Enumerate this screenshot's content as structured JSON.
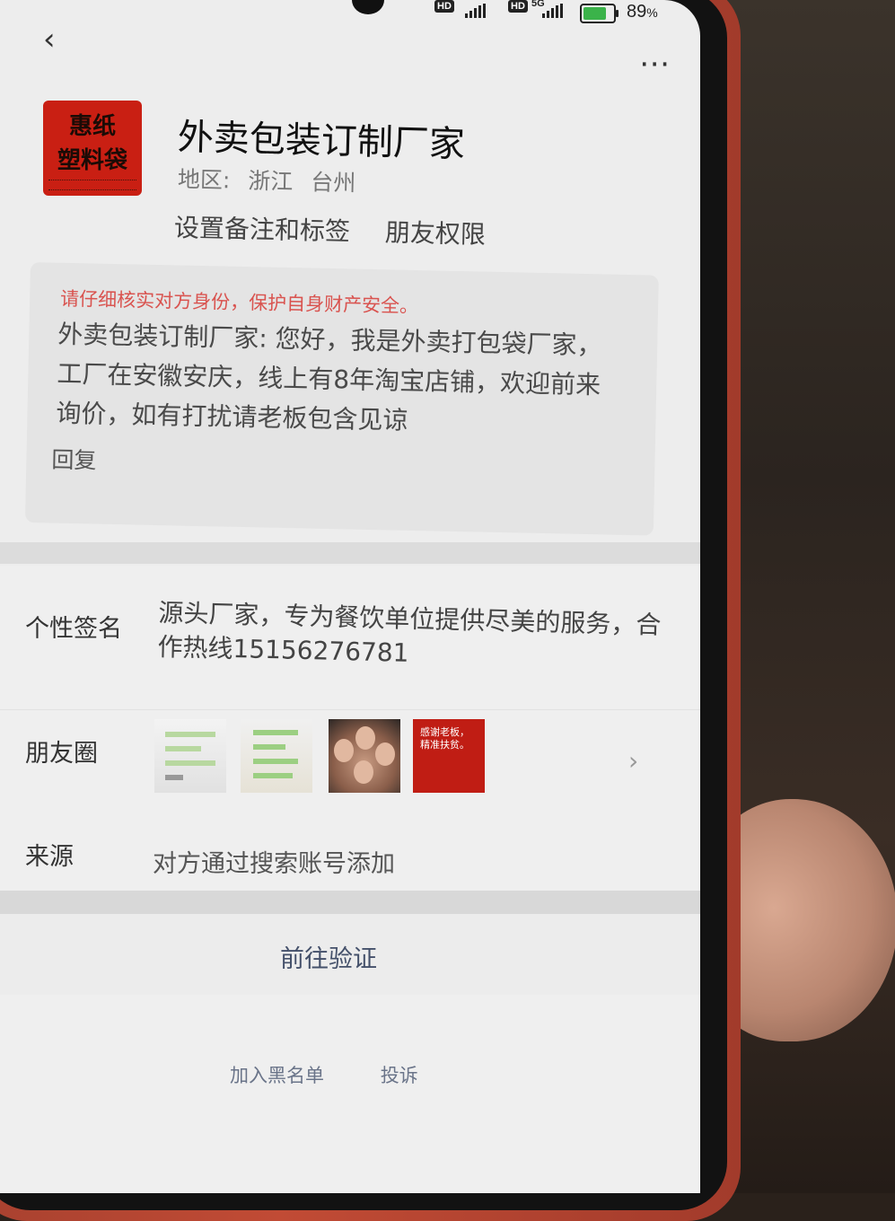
{
  "status_bar": {
    "hd_badges": [
      "HD",
      "HD"
    ],
    "network": "5G",
    "battery_percent": "89",
    "battery_unit": "%",
    "battery_level": 0.89
  },
  "header": {
    "back_icon": "chevron-left-icon",
    "more_icon": "ellipsis-icon"
  },
  "profile": {
    "avatar_text_line1": "惠纸",
    "avatar_text_line2": "塑料袋",
    "name": "外卖包装订制厂家",
    "region_label": "地区:",
    "region_province": "浙江",
    "region_city": "台州",
    "set_remark_label": "设置备注和标签",
    "friend_permission_label": "朋友权限"
  },
  "request_card": {
    "warning": "请仔细核实对方身份，保护自身财产安全。",
    "message": "外卖包装订制厂家: 您好，我是外卖打包袋厂家，工厂在安徽安庆，线上有8年淘宝店铺，欢迎前来询价，如有打扰请老板包含见谅",
    "reply_label": "回复"
  },
  "signature": {
    "label": "个性签名",
    "text": "源头厂家，专为餐饮单位提供尽美的服务，合作热线15156276781"
  },
  "moments": {
    "label": "朋友圈",
    "thumb4_text": "感谢老板，精准扶贫。",
    "chevron_icon": "chevron-right-icon"
  },
  "source": {
    "label": "来源",
    "text": "对方通过搜索账号添加"
  },
  "verify_button": "前往验证",
  "bottom_links": {
    "blacklist": "加入黑名单",
    "report": "投诉"
  },
  "colors": {
    "warning": "#d9534f",
    "link": "#44506a",
    "avatar_bg": "#c91f13",
    "case": "#c14b35"
  }
}
